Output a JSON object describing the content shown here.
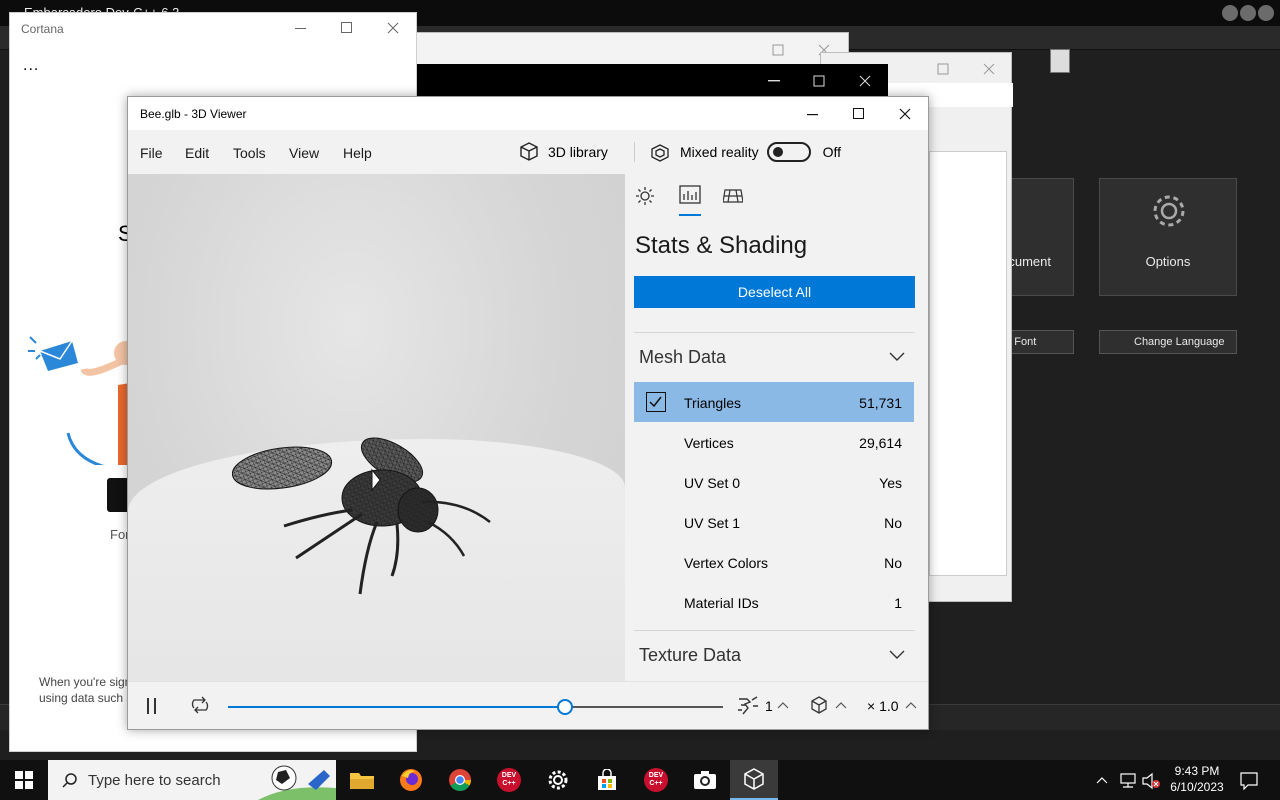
{
  "cortana": {
    "title": "Cortana",
    "more": "...",
    "partial_letter": "S",
    "partial_for": "For",
    "partial_foot_1": "When you're sign",
    "partial_foot_2": "using data such a"
  },
  "devcpp": {
    "title": "Embarcadero Dev-C++ 6.3",
    "cards": [
      {
        "label": "cument"
      },
      {
        "label": "Options"
      }
    ],
    "buttons": [
      {
        "label": "ge Font"
      },
      {
        "label": "Change Language"
      }
    ]
  },
  "viewer": {
    "title": "Bee.glb - 3D Viewer",
    "menu": [
      "File",
      "Edit",
      "Tools",
      "View",
      "Help"
    ],
    "library_label": "3D library",
    "mixed_reality_label": "Mixed reality",
    "mixed_reality_state": "Off",
    "panel": {
      "heading": "Stats & Shading",
      "deselect_label": "Deselect All",
      "mesh_section": "Mesh Data",
      "texture_section": "Texture Data",
      "rows": [
        {
          "key": "Triangles",
          "value": "51,731",
          "checked": true
        },
        {
          "key": "Vertices",
          "value": "29,614"
        },
        {
          "key": "UV Set 0",
          "value": "Yes"
        },
        {
          "key": "UV Set 1",
          "value": "No"
        },
        {
          "key": "Vertex Colors",
          "value": "No"
        },
        {
          "key": "Material IDs",
          "value": "1"
        }
      ]
    },
    "playback": {
      "progress": 0.68,
      "animation_count": "1",
      "speed": "× 1.0"
    },
    "accent": "#0078d7"
  },
  "taskbar": {
    "search_placeholder": "Type here to search",
    "time": "9:43 PM",
    "date": "6/10/2023",
    "devcpp_badge": "DEV C++"
  }
}
